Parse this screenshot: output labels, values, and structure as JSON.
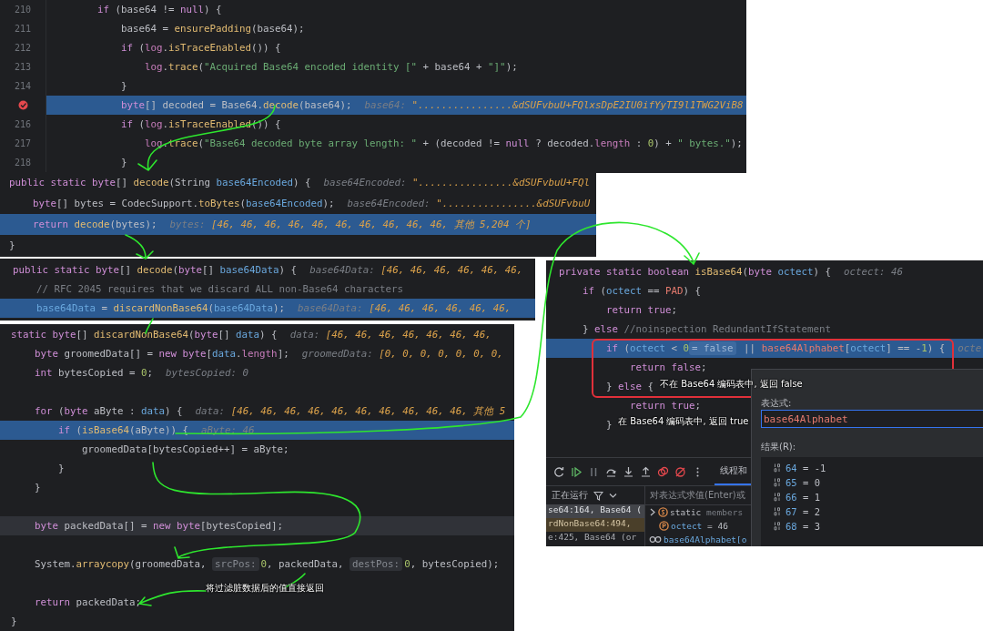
{
  "editors": [
    {
      "lines": [
        {
          "number": "210",
          "breakpoint": false,
          "highlighted": false,
          "code": [
            {
              "kind": "kw",
              "text": "        if"
            },
            {
              "kind": "plain",
              "text": " (base64 != "
            },
            {
              "kind": "kw",
              "text": "null"
            },
            {
              "kind": "plain",
              "text": ") {"
            }
          ]
        },
        {
          "number": "211",
          "breakpoint": false,
          "highlighted": false,
          "code": [
            {
              "kind": "plain",
              "text": "            base64 = "
            },
            {
              "kind": "fn",
              "text": "ensurePadding"
            },
            {
              "kind": "plain",
              "text": "(base64);"
            }
          ]
        },
        {
          "number": "212",
          "breakpoint": false,
          "highlighted": false,
          "code": [
            {
              "kind": "kw",
              "text": "            if"
            },
            {
              "kind": "plain",
              "text": " ("
            },
            {
              "kind": "field",
              "text": "log"
            },
            {
              "kind": "plain",
              "text": "."
            },
            {
              "kind": "fn",
              "text": "isTraceEnabled"
            },
            {
              "kind": "plain",
              "text": "()) {"
            }
          ]
        },
        {
          "number": "213",
          "breakpoint": false,
          "highlighted": false,
          "code": [
            {
              "kind": "field",
              "text": "                log"
            },
            {
              "kind": "plain",
              "text": "."
            },
            {
              "kind": "fn",
              "text": "trace"
            },
            {
              "kind": "plain",
              "text": "("
            },
            {
              "kind": "str",
              "text": "\"Acquired Base64 encoded identity [\""
            },
            {
              "kind": "plain",
              "text": " + base64 + "
            },
            {
              "kind": "str",
              "text": "\"]\""
            },
            {
              "kind": "plain",
              "text": ");"
            }
          ]
        },
        {
          "number": "214",
          "breakpoint": false,
          "highlighted": false,
          "code": [
            {
              "kind": "plain",
              "text": "            }"
            }
          ]
        },
        {
          "breakpoint": true,
          "highlighted": true,
          "code": [
            {
              "kind": "kw",
              "text": "            byte"
            },
            {
              "kind": "plain",
              "text": "[] decoded = Base64."
            },
            {
              "kind": "fn",
              "text": "decode"
            },
            {
              "kind": "plain",
              "text": "(base64);"
            }
          ],
          "hint": [
            {
              "kind": "label",
              "text": "base64: "
            },
            {
              "kind": "value",
              "text": "\"................&dSUFvbuU+FQlxsDpE2IU0ifYyTI9l1TWG2ViB8"
            }
          ]
        },
        {
          "number": "216",
          "breakpoint": false,
          "highlighted": false,
          "code": [
            {
              "kind": "kw",
              "text": "            if"
            },
            {
              "kind": "plain",
              "text": " ("
            },
            {
              "kind": "field",
              "text": "log"
            },
            {
              "kind": "plain",
              "text": "."
            },
            {
              "kind": "fn",
              "text": "isTraceEnabled"
            },
            {
              "kind": "plain",
              "text": "()) {"
            }
          ]
        },
        {
          "number": "217",
          "breakpoint": false,
          "highlighted": false,
          "code": [
            {
              "kind": "field",
              "text": "                log"
            },
            {
              "kind": "plain",
              "text": "."
            },
            {
              "kind": "fn",
              "text": "trace"
            },
            {
              "kind": "plain",
              "text": "("
            },
            {
              "kind": "str",
              "text": "\"Base64 decoded byte array length: \""
            },
            {
              "kind": "plain",
              "text": " + (decoded != "
            },
            {
              "kind": "kw",
              "text": "null"
            },
            {
              "kind": "plain",
              "text": " ? decoded."
            },
            {
              "kind": "field",
              "text": "length"
            },
            {
              "kind": "plain",
              "text": " : "
            },
            {
              "kind": "num",
              "text": "0"
            },
            {
              "kind": "plain",
              "text": ") + "
            },
            {
              "kind": "str",
              "text": "\" bytes.\""
            },
            {
              "kind": "plain",
              "text": ");"
            }
          ]
        },
        {
          "number": "218",
          "breakpoint": false,
          "highlighted": false,
          "code": [
            {
              "kind": "plain",
              "text": "            }"
            }
          ]
        }
      ]
    },
    {
      "lines": [
        {
          "highlighted": false,
          "code": [
            {
              "kind": "kw",
              "text": "public static byte"
            },
            {
              "kind": "plain",
              "text": "[] "
            },
            {
              "kind": "fn",
              "text": "decode"
            },
            {
              "kind": "plain",
              "text": "(String "
            },
            {
              "kind": "var",
              "text": "base64Encoded"
            },
            {
              "kind": "plain",
              "text": ") {"
            }
          ],
          "hint": [
            {
              "kind": "label",
              "text": "base64Encoded: "
            },
            {
              "kind": "value",
              "text": "\"................&dSUFvbuU+FQl"
            }
          ]
        },
        {
          "highlighted": false,
          "code": [
            {
              "kind": "kw",
              "text": "    byte"
            },
            {
              "kind": "plain",
              "text": "[] bytes = CodecSupport."
            },
            {
              "kind": "fn",
              "text": "toBytes"
            },
            {
              "kind": "plain",
              "text": "("
            },
            {
              "kind": "var",
              "text": "base64Encoded"
            },
            {
              "kind": "plain",
              "text": ");"
            }
          ],
          "hint": [
            {
              "kind": "label",
              "text": "base64Encoded: "
            },
            {
              "kind": "value",
              "text": "\"................&dSUFvbuU"
            }
          ]
        },
        {
          "highlighted": true,
          "code": [
            {
              "kind": "kw",
              "text": "    return "
            },
            {
              "kind": "fn",
              "text": "decode"
            },
            {
              "kind": "plain",
              "text": "(bytes);"
            }
          ],
          "hint": [
            {
              "kind": "label",
              "text": "bytes: "
            },
            {
              "kind": "value",
              "text": "[46, 46, 46, 46, 46, 46, 46, 46, 46, 46, 其他 5,204 个]"
            }
          ]
        },
        {
          "highlighted": false,
          "code": [
            {
              "kind": "plain",
              "text": "}"
            }
          ]
        }
      ]
    },
    {
      "lines": [
        {
          "highlighted": false,
          "code": [
            {
              "kind": "kw",
              "text": "public static byte"
            },
            {
              "kind": "plain",
              "text": "[] "
            },
            {
              "kind": "fn",
              "text": "decode"
            },
            {
              "kind": "plain",
              "text": "("
            },
            {
              "kind": "kw",
              "text": "byte"
            },
            {
              "kind": "plain",
              "text": "[] "
            },
            {
              "kind": "var",
              "text": "base64Data"
            },
            {
              "kind": "plain",
              "text": ") {"
            }
          ],
          "hint": [
            {
              "kind": "label",
              "text": "base64Data: "
            },
            {
              "kind": "value",
              "text": "[46, 46, 46, 46, 46, 46,"
            }
          ]
        },
        {
          "highlighted": false,
          "code": [
            {
              "kind": "cmt",
              "text": "    // RFC 2045 requires that we discard ALL non-Base64 characters"
            }
          ]
        },
        {
          "highlighted": true,
          "code": [
            {
              "kind": "var",
              "text": "    base64Data"
            },
            {
              "kind": "plain",
              "text": " = "
            },
            {
              "kind": "fn",
              "text": "discardNonBase64"
            },
            {
              "kind": "plain",
              "text": "("
            },
            {
              "kind": "var",
              "text": "base64Data"
            },
            {
              "kind": "plain",
              "text": ");"
            }
          ],
          "hint": [
            {
              "kind": "label",
              "text": "base64Data: "
            },
            {
              "kind": "value",
              "text": "[46, 46, 46, 46, 46, 46,"
            }
          ]
        }
      ]
    },
    {
      "lines": [
        {
          "highlighted": false,
          "code": [
            {
              "kind": "kw",
              "text": "static byte"
            },
            {
              "kind": "plain",
              "text": "[] "
            },
            {
              "kind": "fn",
              "text": "discardNonBase64"
            },
            {
              "kind": "plain",
              "text": "("
            },
            {
              "kind": "kw",
              "text": "byte"
            },
            {
              "kind": "plain",
              "text": "[] "
            },
            {
              "kind": "var",
              "text": "data"
            },
            {
              "kind": "plain",
              "text": ") {"
            }
          ],
          "hint": [
            {
              "kind": "label",
              "text": "data: "
            },
            {
              "kind": "value",
              "text": "[46, 46, 46, 46, 46, 46, 46,"
            }
          ]
        },
        {
          "highlighted": false,
          "code": [
            {
              "kind": "kw",
              "text": "    byte"
            },
            {
              "kind": "plain",
              "text": " groomedData[] = "
            },
            {
              "kind": "kw",
              "text": "new byte"
            },
            {
              "kind": "plain",
              "text": "["
            },
            {
              "kind": "var",
              "text": "data"
            },
            {
              "kind": "plain",
              "text": "."
            },
            {
              "kind": "field",
              "text": "length"
            },
            {
              "kind": "plain",
              "text": "];"
            }
          ],
          "hint": [
            {
              "kind": "label",
              "text": "groomedData: "
            },
            {
              "kind": "value",
              "text": "[0, 0, 0, 0, 0, 0, 0,"
            }
          ]
        },
        {
          "highlighted": false,
          "code": [
            {
              "kind": "kw",
              "text": "    int"
            },
            {
              "kind": "plain",
              "text": " bytesCopied = "
            },
            {
              "kind": "num",
              "text": "0"
            },
            {
              "kind": "plain",
              "text": ";"
            }
          ],
          "hint": [
            {
              "kind": "label",
              "text": "bytesCopied: 0"
            }
          ]
        },
        {
          "highlighted": false
        },
        {
          "highlighted": false,
          "code": [
            {
              "kind": "kw",
              "text": "    for"
            },
            {
              "kind": "plain",
              "text": " ("
            },
            {
              "kind": "kw",
              "text": "byte"
            },
            {
              "kind": "plain",
              "text": " aByte : "
            },
            {
              "kind": "var",
              "text": "data"
            },
            {
              "kind": "plain",
              "text": ") {"
            }
          ],
          "hint": [
            {
              "kind": "label",
              "text": "data: "
            },
            {
              "kind": "value",
              "text": "[46, 46, 46, 46, 46, 46, 46, 46, 46, 46, 其他 5"
            }
          ]
        },
        {
          "highlighted": true,
          "code": [
            {
              "kind": "kw",
              "text": "        if"
            },
            {
              "kind": "plain",
              "text": " ("
            },
            {
              "kind": "fn",
              "text": "isBase64"
            },
            {
              "kind": "plain",
              "text": "(aByte)) {"
            }
          ],
          "hint": [
            {
              "kind": "label",
              "text": "aByte: 46"
            }
          ]
        },
        {
          "highlighted": false,
          "code": [
            {
              "kind": "plain",
              "text": "            groomedData[bytesCopied++] = aByte;"
            }
          ]
        },
        {
          "highlighted": false,
          "code": [
            {
              "kind": "plain",
              "text": "        }"
            }
          ]
        },
        {
          "highlighted": false,
          "code": [
            {
              "kind": "plain",
              "text": "    }"
            }
          ]
        },
        {
          "highlighted": false
        },
        {
          "highlighted": false,
          "caret": true,
          "code": [
            {
              "kind": "kw",
              "text": "    byte"
            },
            {
              "kind": "plain",
              "text": " packedData[] = "
            },
            {
              "kind": "kw",
              "text": "new byte"
            },
            {
              "kind": "plain",
              "text": "[bytesCopied];"
            }
          ]
        },
        {
          "highlighted": false
        },
        {
          "highlighted": false,
          "code": [
            {
              "kind": "plain",
              "text": "    System."
            },
            {
              "kind": "fn",
              "text": "arraycopy"
            },
            {
              "kind": "plain",
              "text": "(groomedData, "
            },
            {
              "kind": "param",
              "text": "srcPos:"
            },
            {
              "kind": "num",
              "text": "0"
            },
            {
              "kind": "plain",
              "text": ", packedData, "
            },
            {
              "kind": "param",
              "text": "destPos:"
            },
            {
              "kind": "num",
              "text": "0"
            },
            {
              "kind": "plain",
              "text": ", bytesCopied);"
            }
          ]
        },
        {
          "highlighted": false
        },
        {
          "highlighted": false,
          "code": [
            {
              "kind": "kw",
              "text": "    return"
            },
            {
              "kind": "plain",
              "text": " packedData;"
            }
          ]
        },
        {
          "highlighted": false,
          "code": [
            {
              "kind": "plain",
              "text": "}"
            }
          ]
        }
      ]
    },
    {
      "lines": [
        {
          "highlighted": false,
          "code": [
            {
              "kind": "kw",
              "text": "private static boolean "
            },
            {
              "kind": "fn",
              "text": "isBase64"
            },
            {
              "kind": "plain",
              "text": "("
            },
            {
              "kind": "kw",
              "text": "byte "
            },
            {
              "kind": "var",
              "text": "octect"
            },
            {
              "kind": "plain",
              "text": ") {"
            }
          ],
          "hint": [
            {
              "kind": "label",
              "text": "octect: 46"
            }
          ]
        },
        {
          "highlighted": false,
          "code": [
            {
              "kind": "kw",
              "text": "    if"
            },
            {
              "kind": "plain",
              "text": " ("
            },
            {
              "kind": "var",
              "text": "octect"
            },
            {
              "kind": "plain",
              "text": " == "
            },
            {
              "kind": "const",
              "text": "PAD"
            },
            {
              "kind": "plain",
              "text": ") {"
            }
          ]
        },
        {
          "highlighted": false,
          "code": [
            {
              "kind": "kw",
              "text": "        return true"
            },
            {
              "kind": "plain",
              "text": ";"
            }
          ]
        },
        {
          "highlighted": false,
          "code": [
            {
              "kind": "plain",
              "text": "    } "
            },
            {
              "kind": "kw",
              "text": "else "
            },
            {
              "kind": "cmt",
              "text": "//noinspection RedundantIfStatement"
            }
          ]
        },
        {
          "highlighted": true,
          "code": [
            {
              "kind": "kw",
              "text": "        if"
            },
            {
              "kind": "plain",
              "text": " ("
            },
            {
              "kind": "var",
              "text": "octect"
            },
            {
              "kind": "plain",
              "text": " < "
            },
            {
              "kind": "num",
              "text": "0"
            },
            {
              "kind": "param",
              "text": "= false"
            },
            {
              "kind": "plain",
              "text": " || "
            },
            {
              "kind": "const",
              "text": "base64Alphabet"
            },
            {
              "kind": "plain",
              "text": "["
            },
            {
              "kind": "var",
              "text": "octect"
            },
            {
              "kind": "plain",
              "text": "] == -"
            },
            {
              "kind": "num",
              "text": "1"
            },
            {
              "kind": "plain",
              "text": ") {"
            }
          ],
          "hint": [
            {
              "kind": "label",
              "text": "octe"
            }
          ]
        },
        {
          "highlighted": false,
          "code": [
            {
              "kind": "kw",
              "text": "            return false"
            },
            {
              "kind": "plain",
              "text": ";"
            }
          ]
        },
        {
          "highlighted": false,
          "code": [
            {
              "kind": "plain",
              "text": "        } "
            },
            {
              "kind": "kw",
              "text": "else"
            },
            {
              "kind": "plain",
              "text": " {"
            }
          ]
        },
        {
          "highlighted": false,
          "code": [
            {
              "kind": "kw",
              "text": "            return true"
            },
            {
              "kind": "plain",
              "text": ";"
            }
          ]
        },
        {
          "highlighted": false,
          "code": [
            {
              "kind": "plain",
              "text": "        }"
            }
          ]
        }
      ]
    }
  ],
  "debugger": {
    "tab": {
      "label": "线程和",
      "selected": true
    },
    "status": "正在运行",
    "frames": [
      {
        "text": "se64:164, Base64 (",
        "selected": true,
        "library": false
      },
      {
        "text": "rdNonBase64:494,",
        "selected": false,
        "library": true
      },
      {
        "text": "e:425, Base64 (or",
        "selected": false,
        "library": false
      }
    ],
    "evaluate_placeholder": "对表达式求值(Enter)或",
    "variables": [
      {
        "kind": "static",
        "name": "static",
        "value": "members"
      },
      {
        "kind": "param",
        "name": "octect",
        "value": "= 46"
      },
      {
        "kind": "watch",
        "name": "base64Alphabet[o"
      }
    ]
  },
  "evaluate_dialog": {
    "expression_label": "表达式:",
    "expression": "base64Alphabet",
    "result_label": "结果(R):",
    "results": [
      {
        "key": "64",
        "value": "= -1"
      },
      {
        "key": "65",
        "value": "= 0"
      },
      {
        "key": "66",
        "value": "= 1"
      },
      {
        "key": "67",
        "value": "= 2"
      },
      {
        "key": "68",
        "value": "= 3"
      }
    ]
  },
  "annotations": [
    {
      "text": "不在 Base64 编码表中, 返回 false"
    },
    {
      "text": "在 Base64 编码表中, 返回 true"
    },
    {
      "text": "将过滤脏数据后的值直接返回"
    }
  ]
}
